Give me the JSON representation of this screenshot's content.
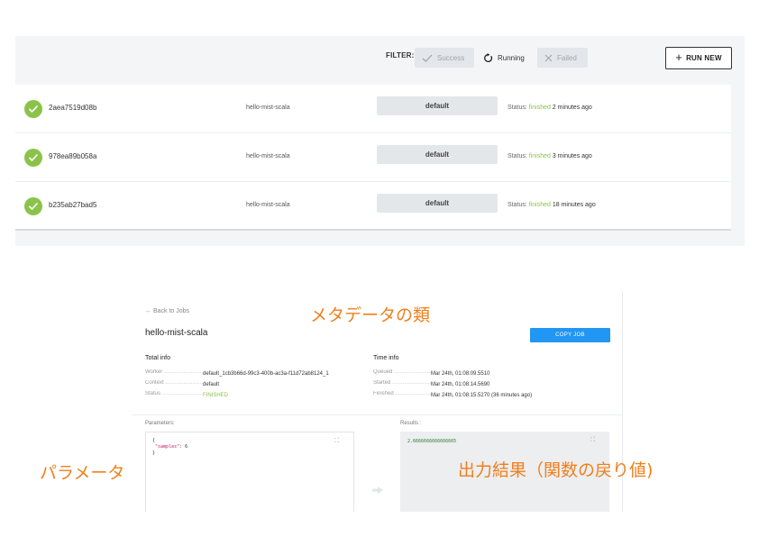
{
  "filter": {
    "label": "FILTER:",
    "success": "Success",
    "running": "Running",
    "failed": "Failed"
  },
  "run_new_label": "RUN NEW",
  "jobs": [
    {
      "id": "2aea7519d08b",
      "function": "hello-mist-scala",
      "context": "default",
      "status_prefix": "Status:",
      "status": "finished",
      "ago": "2 minutes ago"
    },
    {
      "id": "978ea89b058a",
      "function": "hello-mist-scala",
      "context": "default",
      "status_prefix": "Status:",
      "status": "finished",
      "ago": "3 minutes ago"
    },
    {
      "id": "b235ab27bad5",
      "function": "hello-mist-scala",
      "context": "default",
      "status_prefix": "Status:",
      "status": "finished",
      "ago": "18 minutes ago"
    }
  ],
  "detail": {
    "back": "← Back to Jobs",
    "title": "hello-mist-scala",
    "copy_button": "COPY JOB",
    "total_info": {
      "heading": "Total info",
      "worker_key": "Worker",
      "worker_val": "default_1cb3b66d-99c3-400b-ac3a-f11d72ab8124_1",
      "context_key": "Context",
      "context_val": "default",
      "status_key": "Status",
      "status_val": "FINISHED"
    },
    "time_info": {
      "heading": "Time info",
      "queued_key": "Queued",
      "queued_val": "Mar 24th, 01:08:09.5510",
      "started_key": "Started",
      "started_val": "Mar 24th, 01:08:14.5690",
      "finished_key": "Finished",
      "finished_val": "Mar 24th, 01:08:15.5270 (36 minutes ago)"
    },
    "parameters_label": "Parameters:",
    "parameters_code": {
      "open": "{",
      "key": "\"samples\"",
      "value": ": 6",
      "close": "}"
    },
    "results_label": "Results :",
    "results_value": "2.6666666666666665"
  },
  "annotations": {
    "metadata": "メタデータの類",
    "parameters": "パラメータ",
    "results": "出力結果（関数の戻り値)"
  },
  "colors": {
    "success_green": "#8bc34a",
    "primary_blue": "#2196f3",
    "annotation_orange": "#f07f1c"
  },
  "icons": {
    "check": "check-circle-icon",
    "running": "refresh-icon",
    "failed": "x-icon",
    "add": "plus-icon",
    "expand": "expand-icon",
    "arrow": "arrow-right-icon"
  }
}
